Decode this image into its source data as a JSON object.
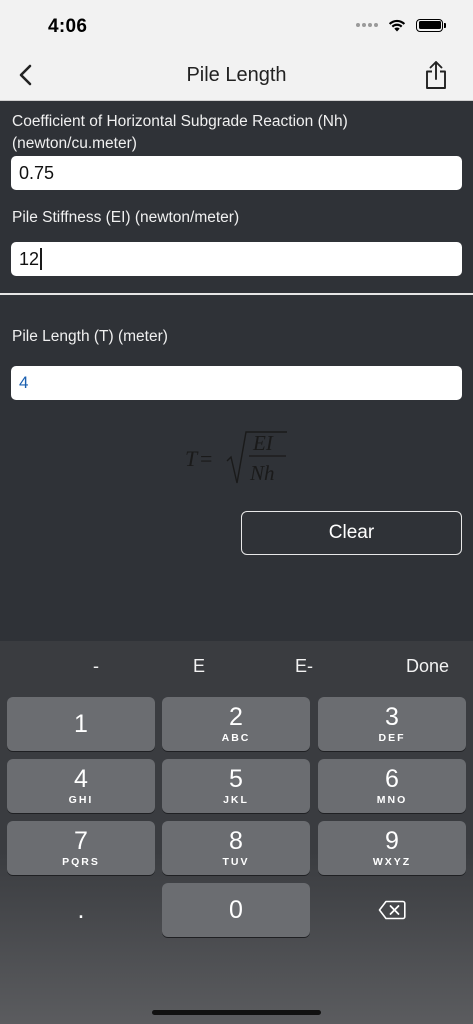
{
  "status_bar": {
    "time": "4:06"
  },
  "nav": {
    "title": "Pile Length",
    "back_icon": "chevron-left-icon",
    "share_icon": "share-icon"
  },
  "form": {
    "nh_label": "Coefficient of Horizontal Subgrade Reaction (Nh)",
    "nh_unit": "(newton/cu.meter)",
    "nh_value": "0.75",
    "ei_label": "Pile Stiffness (EI) (newton/meter)",
    "ei_value": "12",
    "t_label": "Pile Length (T) (meter)",
    "t_value": "4"
  },
  "formula": {
    "lhs": "T",
    "eq": "=",
    "numerator": "EI",
    "denominator": "Nh"
  },
  "clear_label": "Clear",
  "keyboard": {
    "accessory": {
      "minus": "-",
      "e": "E",
      "e_minus": "E-",
      "done": "Done"
    },
    "keys": [
      {
        "digit": "1",
        "letters": ""
      },
      {
        "digit": "2",
        "letters": "ABC"
      },
      {
        "digit": "3",
        "letters": "DEF"
      },
      {
        "digit": "4",
        "letters": "GHI"
      },
      {
        "digit": "5",
        "letters": "JKL"
      },
      {
        "digit": "6",
        "letters": "MNO"
      },
      {
        "digit": "7",
        "letters": "PQRS"
      },
      {
        "digit": "8",
        "letters": "TUV"
      },
      {
        "digit": "9",
        "letters": "WXYZ"
      }
    ],
    "dot": ".",
    "zero": "0"
  }
}
